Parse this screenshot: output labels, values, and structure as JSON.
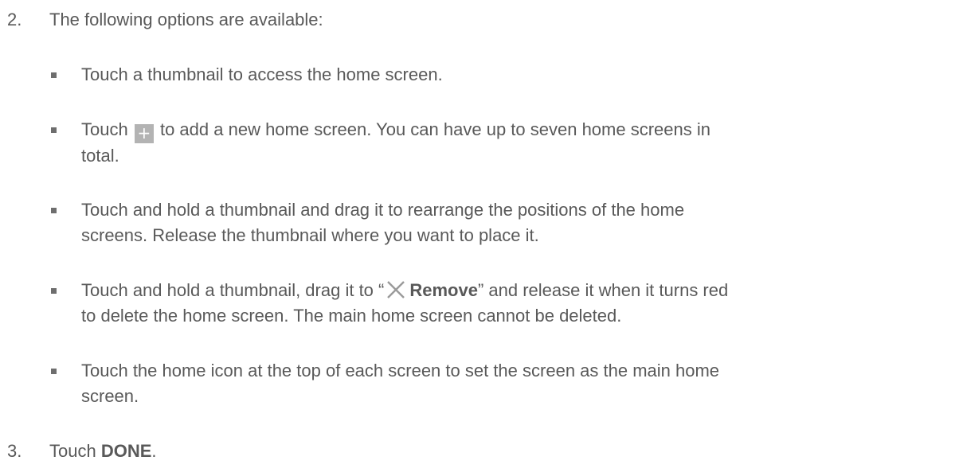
{
  "step2": {
    "number": "2.",
    "text": "The following options are available:"
  },
  "bullets": {
    "b1": {
      "text": "Touch a thumbnail to access the home screen."
    },
    "b2": {
      "before": "Touch",
      "icon": "plus-icon",
      "after_line1": "to add a new home screen. You can have up to seven home screens in",
      "line2": "total."
    },
    "b3": {
      "line1": "Touch and hold a thumbnail and drag it to rearrange the positions of the home",
      "line2": "screens. Release the thumbnail where you want to place it."
    },
    "b4": {
      "before": "Touch and hold a thumbnail, drag it to “",
      "icon": "close-icon",
      "bold": "Remove",
      "after_line1": "” and release it when it turns red",
      "line2": "to delete the home screen. The main home screen cannot be deleted."
    },
    "b5": {
      "line1": "Touch the home icon at the top of each screen to set the screen as the main home",
      "line2": "screen."
    }
  },
  "step3": {
    "number": "3.",
    "before": "Touch",
    "bold": "DONE",
    "after": "."
  },
  "colors": {
    "text": "#595959",
    "bullet": "#6e6e6e",
    "plus_icon_bg": "#b3b3b3",
    "close_icon": "#9a9a9a"
  }
}
